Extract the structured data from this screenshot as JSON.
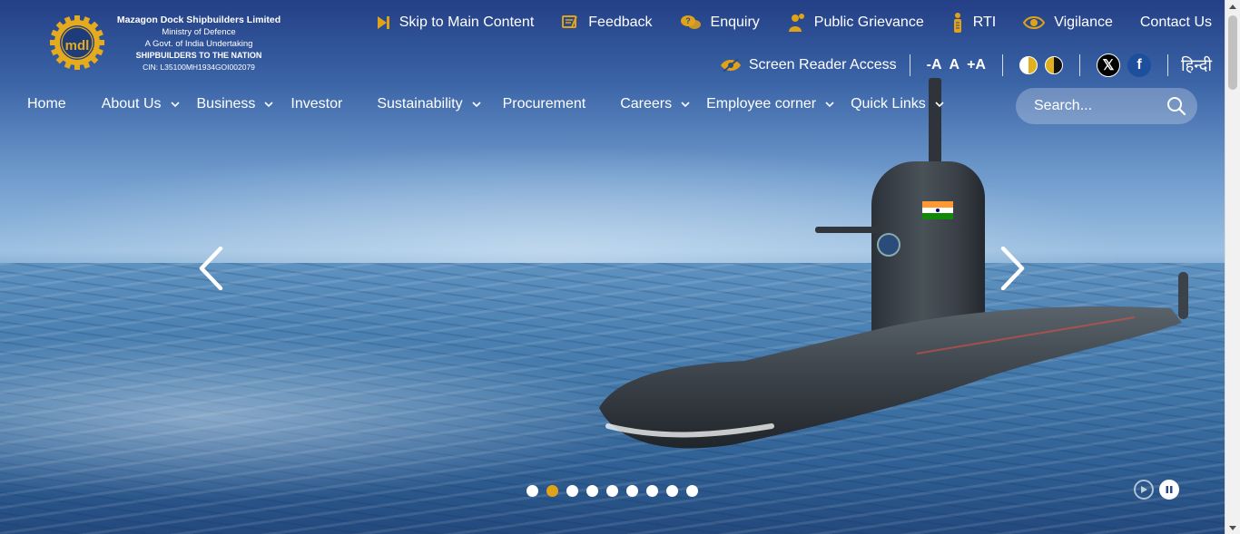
{
  "brand": {
    "name": "Mazagon Dock Shipbuilders Limited",
    "ministry": "Ministry of Defence",
    "undertaking": "A Govt. of India Undertaking",
    "tagline": "SHIPBUILDERS TO THE NATION",
    "cin": "CIN: L35100MH1934GOI002079",
    "logo_letters": "mdl"
  },
  "top_links": [
    {
      "label": "Skip to Main Content",
      "icon": "skip-icon"
    },
    {
      "label": "Feedback",
      "icon": "feedback-icon"
    },
    {
      "label": "Enquiry",
      "icon": "enquiry-icon"
    },
    {
      "label": "Public Grievance",
      "icon": "grievance-icon"
    },
    {
      "label": "RTI",
      "icon": "rti-icon"
    },
    {
      "label": "Vigilance",
      "icon": "eye-icon"
    },
    {
      "label": "Contact Us",
      "icon": ""
    }
  ],
  "accessibility": {
    "screen_reader": "Screen Reader Access",
    "font_decrease": "-A",
    "font_normal": "A",
    "font_increase": "+A",
    "language": "हिन्दी"
  },
  "social": {
    "x_label": "𝕏",
    "facebook_label": "f"
  },
  "nav": [
    {
      "label": "Home",
      "dropdown": false
    },
    {
      "label": "About Us",
      "dropdown": true
    },
    {
      "label": "Business",
      "dropdown": true
    },
    {
      "label": "Investor",
      "dropdown": false
    },
    {
      "label": "Sustainability",
      "dropdown": true
    },
    {
      "label": "Procurement",
      "dropdown": false
    },
    {
      "label": "Careers",
      "dropdown": true
    },
    {
      "label": "Employee corner",
      "dropdown": true
    },
    {
      "label": "Quick Links",
      "dropdown": true
    }
  ],
  "search": {
    "placeholder": "Search..."
  },
  "carousel": {
    "slide_count": 9,
    "active_index": 1
  },
  "colors": {
    "accent": "#e0a318",
    "nav_text": "#ffffff"
  }
}
